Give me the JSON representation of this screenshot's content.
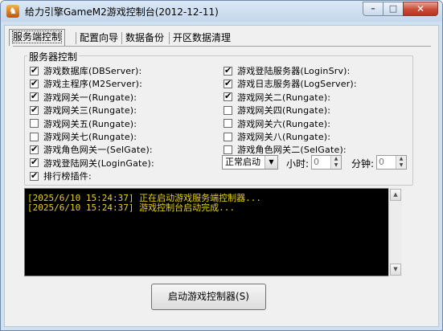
{
  "window": {
    "title": "给力引擎GameM2游戏控制台(2012-12-11)",
    "minimize": "–",
    "maximize": "□",
    "close": "✕"
  },
  "tabs": [
    "服务端控制",
    "配置向导",
    "数据备份",
    "开区数据清理"
  ],
  "group_title": "服务器控制",
  "left_checks": [
    {
      "label": "游戏数据库(DBServer):",
      "checked": true
    },
    {
      "label": "游戏主程序(M2Server):",
      "checked": true
    },
    {
      "label": "游戏网关一(Rungate):",
      "checked": true
    },
    {
      "label": "游戏网关三(Rungate):",
      "checked": true
    },
    {
      "label": "游戏网关五(Rungate):",
      "checked": false
    },
    {
      "label": "游戏网关七(Rungate):",
      "checked": false
    },
    {
      "label": "游戏角色网关一(SelGate):",
      "checked": true
    },
    {
      "label": "游戏登陆网关(LoginGate):",
      "checked": true
    },
    {
      "label": "排行榜插件:",
      "checked": true
    }
  ],
  "right_checks": [
    {
      "label": "游戏登陆服务器(LoginSrv):",
      "checked": true
    },
    {
      "label": "游戏日志服务器(LogServer):",
      "checked": true
    },
    {
      "label": "游戏网关二(Rungate):",
      "checked": true
    },
    {
      "label": "游戏网关四(Rungate):",
      "checked": false
    },
    {
      "label": "游戏网关六(Rungate):",
      "checked": false
    },
    {
      "label": "游戏网关八(Rungate):",
      "checked": false
    },
    {
      "label": "游戏角色网关二(SelGate):",
      "checked": false
    }
  ],
  "schedule": {
    "mode": "正常启动",
    "hour_label": "小时:",
    "hour_value": "0",
    "minute_label": "分钟:",
    "minute_value": "0"
  },
  "log": [
    "[2025/6/10 15:24:37] 正在启动游戏服务端控制器...",
    "[2025/6/10 15:24:37] 游戏控制台启动完成..."
  ],
  "start_button": "启动游戏控制器(S)",
  "colors": {
    "log_text": "#e7d21b",
    "log_bg": "#000000"
  }
}
